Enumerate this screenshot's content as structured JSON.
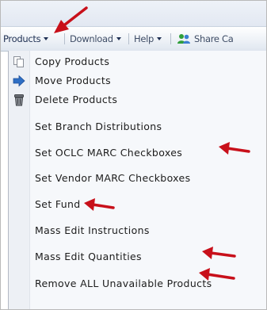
{
  "toolbar": {
    "products_label": "Products",
    "download_label": "Download",
    "help_label": "Help",
    "share_label": "Share Ca"
  },
  "menu": {
    "items": [
      {
        "label": "Copy Products",
        "icon": "copy-icon"
      },
      {
        "label": "Move Products",
        "icon": "arrow-right-icon"
      },
      {
        "label": "Delete Products",
        "icon": "trash-icon"
      },
      {
        "label": "Set Branch Distributions"
      },
      {
        "label": "Set OCLC MARC Checkboxes"
      },
      {
        "label": "Set Vendor MARC Checkboxes"
      },
      {
        "label": "Set Fund"
      },
      {
        "label": "Mass Edit Instructions"
      },
      {
        "label": "Mass Edit Quantities"
      },
      {
        "label": "Remove ALL Unavailable Products"
      }
    ]
  },
  "colors": {
    "annotation_arrow": "#c8101a",
    "toolbar_text": "#1e2f52",
    "move_icon": "#2f6fc4"
  }
}
